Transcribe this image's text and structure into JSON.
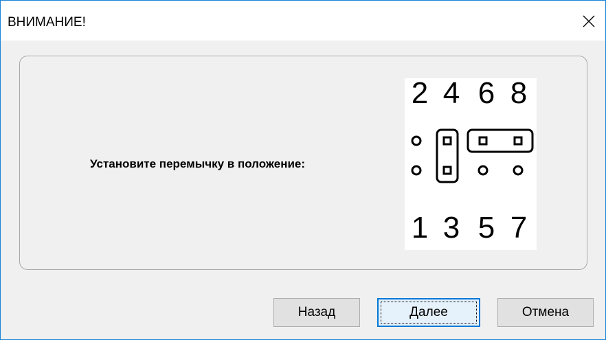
{
  "window": {
    "title": "ВНИМАНИЕ!"
  },
  "icons": {
    "close": "close-icon"
  },
  "main": {
    "message": "Установите перемычку в положение:",
    "jumper_diagram": {
      "top_labels": [
        "2",
        "4",
        "6",
        "8"
      ],
      "bottom_labels": [
        "1",
        "3",
        "5",
        "7"
      ],
      "bridged_pairs": [
        [
          "3",
          "4"
        ],
        [
          "6",
          "8"
        ]
      ]
    }
  },
  "buttons": {
    "back": "Назад",
    "next": "Далее",
    "cancel": "Отмена"
  },
  "colors": {
    "window_border": "#1883d7",
    "focus_border": "#0078d7",
    "background": "#f0f0f0"
  }
}
